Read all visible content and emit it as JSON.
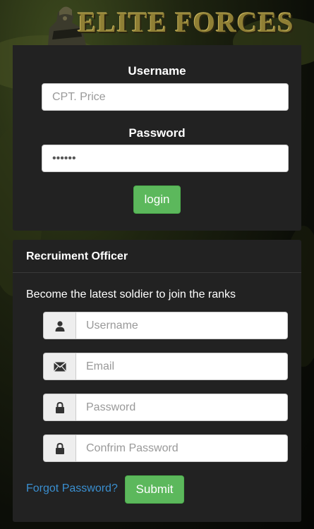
{
  "header": {
    "title": "ELITE FORCES"
  },
  "login": {
    "username_label": "Username",
    "username_placeholder": "CPT. Price",
    "password_label": "Password",
    "password_value": "******",
    "login_label": "login"
  },
  "register": {
    "heading": "Recruiment Officer",
    "tagline": "Become the latest soldier to join the ranks",
    "username_placeholder": "Username",
    "email_placeholder": "Email",
    "password_placeholder": "Password",
    "confirm_placeholder": "Confrim Password",
    "forgot_label": "Forgot Password?",
    "submit_label": "Submit"
  },
  "icons": {
    "username": "user-icon",
    "email": "envelope-icon",
    "password": "lock-icon",
    "confirm": "lock-icon"
  },
  "colors": {
    "accent": "#5cb85c",
    "link": "#3a8fd0",
    "panel": "#222222"
  }
}
